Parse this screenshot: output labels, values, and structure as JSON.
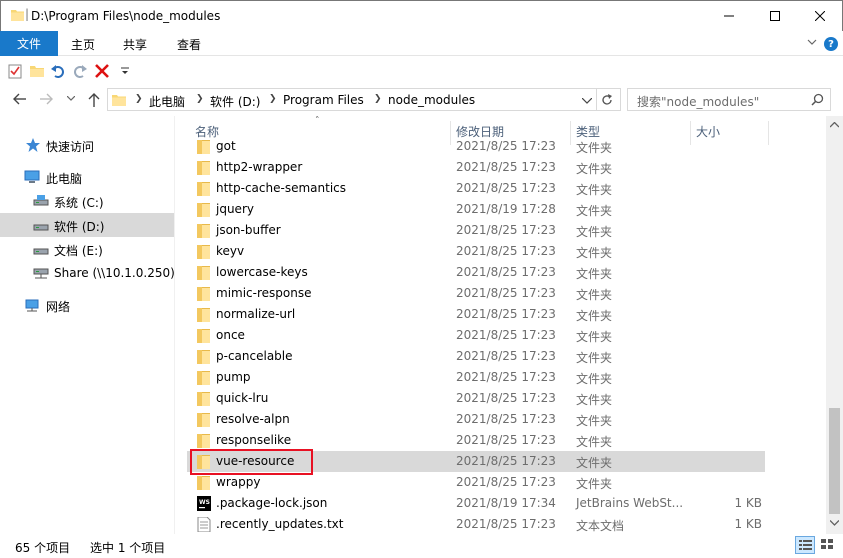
{
  "window": {
    "title": "D:\\Program Files\\node_modules"
  },
  "ribbon": {
    "tabs": [
      "文件",
      "主页",
      "共享",
      "查看"
    ]
  },
  "address": {
    "crumbs": [
      "此电脑",
      "软件 (D:)",
      "Program Files",
      "node_modules"
    ]
  },
  "search": {
    "placeholder": "搜索\"node_modules\""
  },
  "nav": {
    "items": [
      {
        "label": "快速访问",
        "icon": "star-icon"
      },
      {
        "label": "此电脑",
        "icon": "computer-icon"
      },
      {
        "label": "系统 (C:)",
        "icon": "drive-icon"
      },
      {
        "label": "软件 (D:)",
        "icon": "drive-icon"
      },
      {
        "label": "文档 (E:)",
        "icon": "drive-icon"
      },
      {
        "label": "Share (\\\\10.1.0.250) (",
        "icon": "network-drive-icon"
      },
      {
        "label": "网络",
        "icon": "network-icon"
      }
    ]
  },
  "columns": {
    "name": "名称",
    "date": "修改日期",
    "type": "类型",
    "size": "大小"
  },
  "files": [
    {
      "name": "got",
      "date": "2021/8/25 17:23",
      "type": "文件夹",
      "size": "",
      "icon": "folder-icon"
    },
    {
      "name": "http2-wrapper",
      "date": "2021/8/25 17:23",
      "type": "文件夹",
      "size": "",
      "icon": "folder-icon"
    },
    {
      "name": "http-cache-semantics",
      "date": "2021/8/25 17:23",
      "type": "文件夹",
      "size": "",
      "icon": "folder-icon"
    },
    {
      "name": "jquery",
      "date": "2021/8/19 17:28",
      "type": "文件夹",
      "size": "",
      "icon": "folder-icon"
    },
    {
      "name": "json-buffer",
      "date": "2021/8/25 17:23",
      "type": "文件夹",
      "size": "",
      "icon": "folder-icon"
    },
    {
      "name": "keyv",
      "date": "2021/8/25 17:23",
      "type": "文件夹",
      "size": "",
      "icon": "folder-icon"
    },
    {
      "name": "lowercase-keys",
      "date": "2021/8/25 17:23",
      "type": "文件夹",
      "size": "",
      "icon": "folder-icon"
    },
    {
      "name": "mimic-response",
      "date": "2021/8/25 17:23",
      "type": "文件夹",
      "size": "",
      "icon": "folder-icon"
    },
    {
      "name": "normalize-url",
      "date": "2021/8/25 17:23",
      "type": "文件夹",
      "size": "",
      "icon": "folder-icon"
    },
    {
      "name": "once",
      "date": "2021/8/25 17:23",
      "type": "文件夹",
      "size": "",
      "icon": "folder-icon"
    },
    {
      "name": "p-cancelable",
      "date": "2021/8/25 17:23",
      "type": "文件夹",
      "size": "",
      "icon": "folder-icon"
    },
    {
      "name": "pump",
      "date": "2021/8/25 17:23",
      "type": "文件夹",
      "size": "",
      "icon": "folder-icon"
    },
    {
      "name": "quick-lru",
      "date": "2021/8/25 17:23",
      "type": "文件夹",
      "size": "",
      "icon": "folder-icon"
    },
    {
      "name": "resolve-alpn",
      "date": "2021/8/25 17:23",
      "type": "文件夹",
      "size": "",
      "icon": "folder-icon"
    },
    {
      "name": "responselike",
      "date": "2021/8/25 17:23",
      "type": "文件夹",
      "size": "",
      "icon": "folder-icon"
    },
    {
      "name": "vue-resource",
      "date": "2021/8/25 17:23",
      "type": "文件夹",
      "size": "",
      "icon": "folder-icon",
      "selected": true
    },
    {
      "name": "wrappy",
      "date": "2021/8/25 17:23",
      "type": "文件夹",
      "size": "",
      "icon": "folder-icon"
    },
    {
      "name": ".package-lock.json",
      "date": "2021/8/19 17:34",
      "type": "JetBrains WebSt...",
      "size": "1 KB",
      "icon": "webstorm-file-icon"
    },
    {
      "name": ".recently_updates.txt",
      "date": "2021/8/25 17:23",
      "type": "文本文档",
      "size": "1 KB",
      "icon": "text-file-icon"
    }
  ],
  "status": {
    "count": "65 个项目",
    "selected": "选中 1 个项目"
  },
  "colors": {
    "accent": "#1979ca",
    "highlight_box": "#e81123",
    "selected_row": "#d9d9d9"
  }
}
